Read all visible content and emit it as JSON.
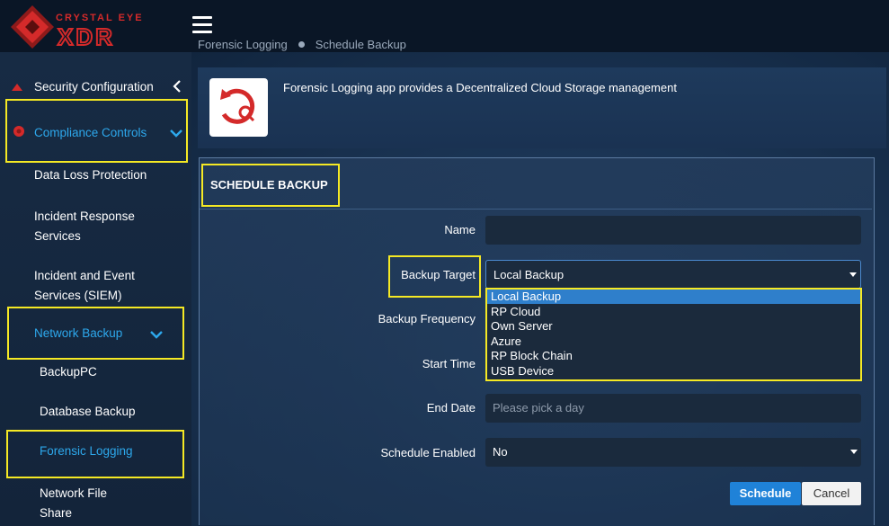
{
  "brand": {
    "line1": "CRYSTAL EYE",
    "line2": "XDR"
  },
  "breadcrumb": [
    "Forensic Logging",
    "Schedule Backup"
  ],
  "sidebar": {
    "items": [
      {
        "label": "Security Configuration"
      },
      {
        "label": "Compliance Controls"
      },
      {
        "label": "Data Loss Protection"
      },
      {
        "label": "Incident Response Services"
      },
      {
        "label": "Incident and Event Services (SIEM)"
      },
      {
        "label": "Network Backup"
      },
      {
        "label": "BackupPC"
      },
      {
        "label": "Database Backup"
      },
      {
        "label": "Forensic Logging"
      },
      {
        "label": "Network File Share"
      }
    ]
  },
  "info": {
    "text": "Forensic Logging app provides a Decentralized Cloud Storage management"
  },
  "card": {
    "title": "SCHEDULE BACKUP"
  },
  "form": {
    "name_label": "Name",
    "name_value": "",
    "target_label": "Backup Target",
    "target_value": "Local Backup",
    "frequency_label": "Backup Frequency",
    "start_label": "Start Time",
    "end_label": "End Date",
    "end_placeholder": "Please pick a day",
    "enabled_label": "Schedule Enabled",
    "enabled_value": "No"
  },
  "target_options": [
    "Local Backup",
    "RP Cloud",
    "Own Server",
    "Azure",
    "RP Block Chain",
    "USB Device"
  ],
  "buttons": {
    "schedule": "Schedule",
    "cancel": "Cancel"
  },
  "colors": {
    "accent": "#2da8ec",
    "highlight": "#f5e924",
    "primary_button": "#1f82d8",
    "logo_red": "#d42a2a"
  }
}
